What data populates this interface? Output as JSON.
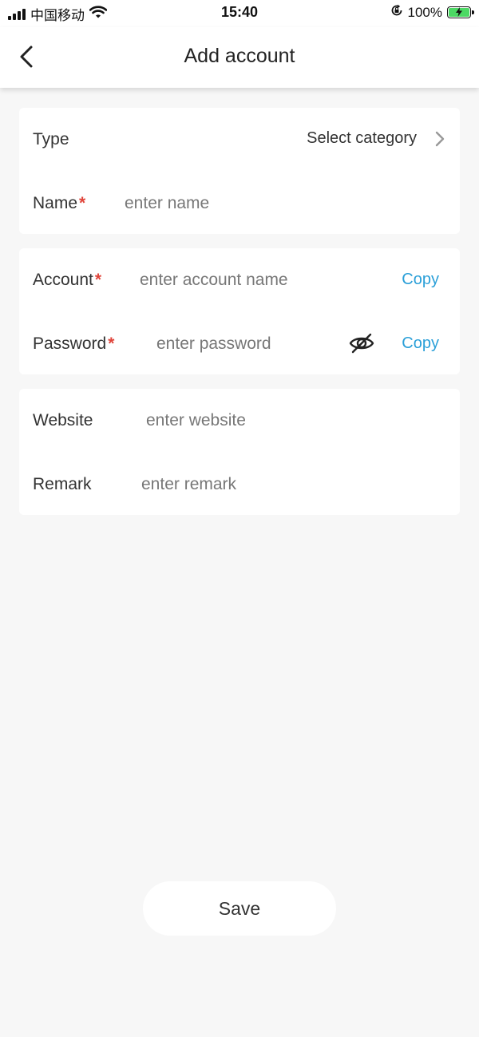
{
  "status_bar": {
    "carrier": "中国移动",
    "time": "15:40",
    "battery_percent": "100%"
  },
  "header": {
    "title": "Add account",
    "back_icon": "chevron-left-icon"
  },
  "form": {
    "type": {
      "label": "Type",
      "value": "Select category"
    },
    "name": {
      "label": "Name",
      "required_mark": "*",
      "placeholder": "enter name"
    },
    "account": {
      "label": "Account",
      "required_mark": "*",
      "placeholder": "enter account name",
      "copy_label": "Copy"
    },
    "password": {
      "label": "Password",
      "required_mark": "*",
      "placeholder": "enter password",
      "copy_label": "Copy",
      "visibility_icon": "eye-off-icon"
    },
    "website": {
      "label": "Website",
      "placeholder": "enter website"
    },
    "remark": {
      "label": "Remark",
      "placeholder": "enter remark"
    }
  },
  "save_label": "Save",
  "colors": {
    "background": "#f7f7f7",
    "card": "#ffffff",
    "required": "#e0443a",
    "link": "#2a9fd8",
    "battery": "#4cd964"
  }
}
